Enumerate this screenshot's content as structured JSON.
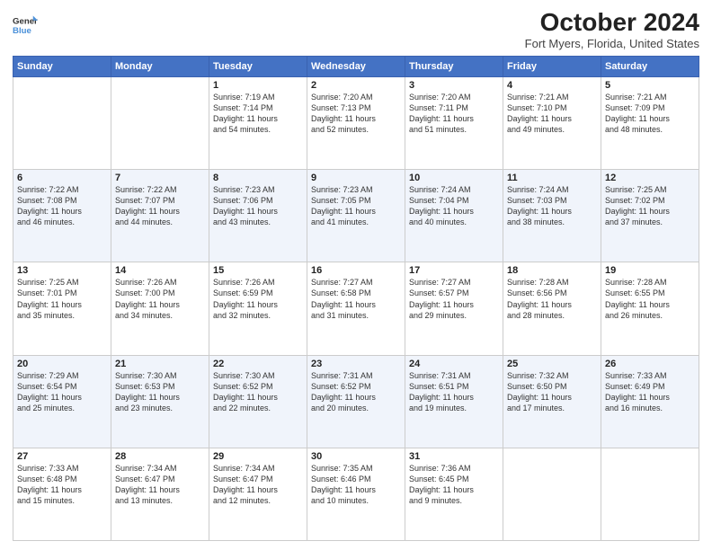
{
  "logo": {
    "line1": "General",
    "line2": "Blue"
  },
  "title": "October 2024",
  "subtitle": "Fort Myers, Florida, United States",
  "days_of_week": [
    "Sunday",
    "Monday",
    "Tuesday",
    "Wednesday",
    "Thursday",
    "Friday",
    "Saturday"
  ],
  "weeks": [
    [
      {
        "day": "",
        "detail": ""
      },
      {
        "day": "",
        "detail": ""
      },
      {
        "day": "1",
        "detail": "Sunrise: 7:19 AM\nSunset: 7:14 PM\nDaylight: 11 hours\nand 54 minutes."
      },
      {
        "day": "2",
        "detail": "Sunrise: 7:20 AM\nSunset: 7:13 PM\nDaylight: 11 hours\nand 52 minutes."
      },
      {
        "day": "3",
        "detail": "Sunrise: 7:20 AM\nSunset: 7:11 PM\nDaylight: 11 hours\nand 51 minutes."
      },
      {
        "day": "4",
        "detail": "Sunrise: 7:21 AM\nSunset: 7:10 PM\nDaylight: 11 hours\nand 49 minutes."
      },
      {
        "day": "5",
        "detail": "Sunrise: 7:21 AM\nSunset: 7:09 PM\nDaylight: 11 hours\nand 48 minutes."
      }
    ],
    [
      {
        "day": "6",
        "detail": "Sunrise: 7:22 AM\nSunset: 7:08 PM\nDaylight: 11 hours\nand 46 minutes."
      },
      {
        "day": "7",
        "detail": "Sunrise: 7:22 AM\nSunset: 7:07 PM\nDaylight: 11 hours\nand 44 minutes."
      },
      {
        "day": "8",
        "detail": "Sunrise: 7:23 AM\nSunset: 7:06 PM\nDaylight: 11 hours\nand 43 minutes."
      },
      {
        "day": "9",
        "detail": "Sunrise: 7:23 AM\nSunset: 7:05 PM\nDaylight: 11 hours\nand 41 minutes."
      },
      {
        "day": "10",
        "detail": "Sunrise: 7:24 AM\nSunset: 7:04 PM\nDaylight: 11 hours\nand 40 minutes."
      },
      {
        "day": "11",
        "detail": "Sunrise: 7:24 AM\nSunset: 7:03 PM\nDaylight: 11 hours\nand 38 minutes."
      },
      {
        "day": "12",
        "detail": "Sunrise: 7:25 AM\nSunset: 7:02 PM\nDaylight: 11 hours\nand 37 minutes."
      }
    ],
    [
      {
        "day": "13",
        "detail": "Sunrise: 7:25 AM\nSunset: 7:01 PM\nDaylight: 11 hours\nand 35 minutes."
      },
      {
        "day": "14",
        "detail": "Sunrise: 7:26 AM\nSunset: 7:00 PM\nDaylight: 11 hours\nand 34 minutes."
      },
      {
        "day": "15",
        "detail": "Sunrise: 7:26 AM\nSunset: 6:59 PM\nDaylight: 11 hours\nand 32 minutes."
      },
      {
        "day": "16",
        "detail": "Sunrise: 7:27 AM\nSunset: 6:58 PM\nDaylight: 11 hours\nand 31 minutes."
      },
      {
        "day": "17",
        "detail": "Sunrise: 7:27 AM\nSunset: 6:57 PM\nDaylight: 11 hours\nand 29 minutes."
      },
      {
        "day": "18",
        "detail": "Sunrise: 7:28 AM\nSunset: 6:56 PM\nDaylight: 11 hours\nand 28 minutes."
      },
      {
        "day": "19",
        "detail": "Sunrise: 7:28 AM\nSunset: 6:55 PM\nDaylight: 11 hours\nand 26 minutes."
      }
    ],
    [
      {
        "day": "20",
        "detail": "Sunrise: 7:29 AM\nSunset: 6:54 PM\nDaylight: 11 hours\nand 25 minutes."
      },
      {
        "day": "21",
        "detail": "Sunrise: 7:30 AM\nSunset: 6:53 PM\nDaylight: 11 hours\nand 23 minutes."
      },
      {
        "day": "22",
        "detail": "Sunrise: 7:30 AM\nSunset: 6:52 PM\nDaylight: 11 hours\nand 22 minutes."
      },
      {
        "day": "23",
        "detail": "Sunrise: 7:31 AM\nSunset: 6:52 PM\nDaylight: 11 hours\nand 20 minutes."
      },
      {
        "day": "24",
        "detail": "Sunrise: 7:31 AM\nSunset: 6:51 PM\nDaylight: 11 hours\nand 19 minutes."
      },
      {
        "day": "25",
        "detail": "Sunrise: 7:32 AM\nSunset: 6:50 PM\nDaylight: 11 hours\nand 17 minutes."
      },
      {
        "day": "26",
        "detail": "Sunrise: 7:33 AM\nSunset: 6:49 PM\nDaylight: 11 hours\nand 16 minutes."
      }
    ],
    [
      {
        "day": "27",
        "detail": "Sunrise: 7:33 AM\nSunset: 6:48 PM\nDaylight: 11 hours\nand 15 minutes."
      },
      {
        "day": "28",
        "detail": "Sunrise: 7:34 AM\nSunset: 6:47 PM\nDaylight: 11 hours\nand 13 minutes."
      },
      {
        "day": "29",
        "detail": "Sunrise: 7:34 AM\nSunset: 6:47 PM\nDaylight: 11 hours\nand 12 minutes."
      },
      {
        "day": "30",
        "detail": "Sunrise: 7:35 AM\nSunset: 6:46 PM\nDaylight: 11 hours\nand 10 minutes."
      },
      {
        "day": "31",
        "detail": "Sunrise: 7:36 AM\nSunset: 6:45 PM\nDaylight: 11 hours\nand 9 minutes."
      },
      {
        "day": "",
        "detail": ""
      },
      {
        "day": "",
        "detail": ""
      }
    ]
  ]
}
